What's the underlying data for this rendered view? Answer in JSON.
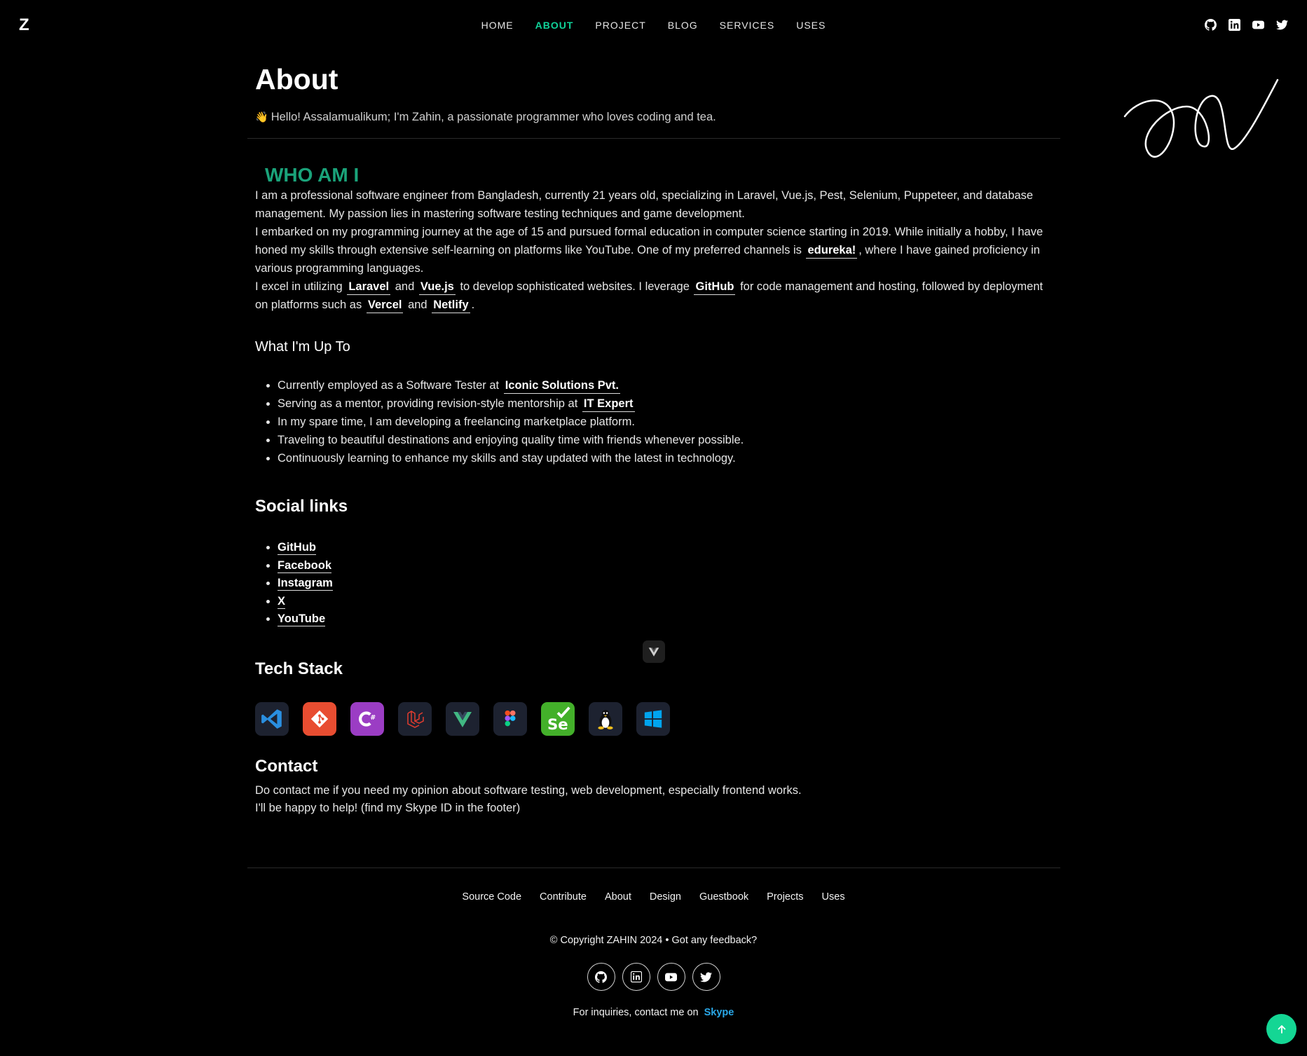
{
  "header": {
    "logo": "Z",
    "nav": [
      {
        "label": "HOME",
        "active": false
      },
      {
        "label": "ABOUT",
        "active": true
      },
      {
        "label": "PROJECT",
        "active": false
      },
      {
        "label": "BLOG",
        "active": false
      },
      {
        "label": "SERVICES",
        "active": false
      },
      {
        "label": "USES",
        "active": false
      }
    ],
    "social_icons": [
      "github-icon",
      "linkedin-icon",
      "youtube-icon",
      "twitter-icon"
    ]
  },
  "page": {
    "title": "About",
    "intro_emoji": "👋",
    "intro": "Hello! Assalamualikum; I'm Zahin, a passionate programmer who loves coding and tea."
  },
  "who": {
    "heading": "WHO AM I",
    "p1": "I am a professional software engineer from Bangladesh, currently 21 years old, specializing in Laravel, Vue.js, Pest, Selenium, Puppeteer, and database management. My passion lies in mastering software testing techniques and game development.",
    "p2_a": "I embarked on my programming journey at the age of 15 and pursued formal education in computer science starting in 2019. While initially a hobby, I have honed my skills through extensive self-learning on platforms like YouTube. One of my preferred channels is",
    "p2_link": "edureka!",
    "p2_b": ", where I have gained proficiency in various programming languages.",
    "p3_a": "I excel in utilizing",
    "p3_link1": "Laravel",
    "p3_b": "and",
    "p3_link2": "Vue.js",
    "p3_c": "to develop sophisticated websites. I leverage",
    "p3_link3": "GitHub",
    "p3_d": "for code management and hosting, followed by deployment on platforms such as",
    "p3_link4": "Vercel",
    "p3_e": "and",
    "p3_link5": "Netlify",
    "p3_f": "."
  },
  "upto": {
    "heading": "What I'm Up To",
    "item1_text": "Currently employed as a Software Tester at",
    "item1_link": "Iconic Solutions Pvt.",
    "item2_text": "Serving as a mentor, providing revision-style mentorship at",
    "item2_link": "IT Expert",
    "item3": "In my spare time, I am developing a freelancing marketplace platform.",
    "item4": "Traveling to beautiful destinations and enjoying quality time with friends whenever possible.",
    "item5": "Continuously learning to enhance my skills and stay updated with the latest in technology."
  },
  "social": {
    "heading": "Social links",
    "links": [
      "GitHub",
      "Facebook",
      "Instagram",
      "X",
      "YouTube"
    ]
  },
  "tech": {
    "heading": "Tech Stack",
    "icons": [
      "vscode-icon",
      "git-icon",
      "csharp-icon",
      "laravel-icon",
      "vue-icon",
      "figma-icon",
      "selenium-icon",
      "linux-icon",
      "windows-icon"
    ]
  },
  "contact": {
    "heading": "Contact",
    "line1": "Do contact me if you need my opinion about software testing, web development, especially frontend works.",
    "line2": "I'll be happy to help! (find my Skype ID in the footer)"
  },
  "footer": {
    "links": [
      "Source Code",
      "Contribute",
      "About",
      "Design",
      "Guestbook",
      "Projects",
      "Uses"
    ],
    "copyright": "© Copyright ZAHIN 2024 • Got any feedback?",
    "inquiry": "For inquiries, contact me on",
    "skype": "Skype"
  },
  "colors": {
    "accent": "#10d39a",
    "heading_green": "#1aa37a",
    "skype_blue": "#2aa8e8",
    "background": "#000000"
  }
}
